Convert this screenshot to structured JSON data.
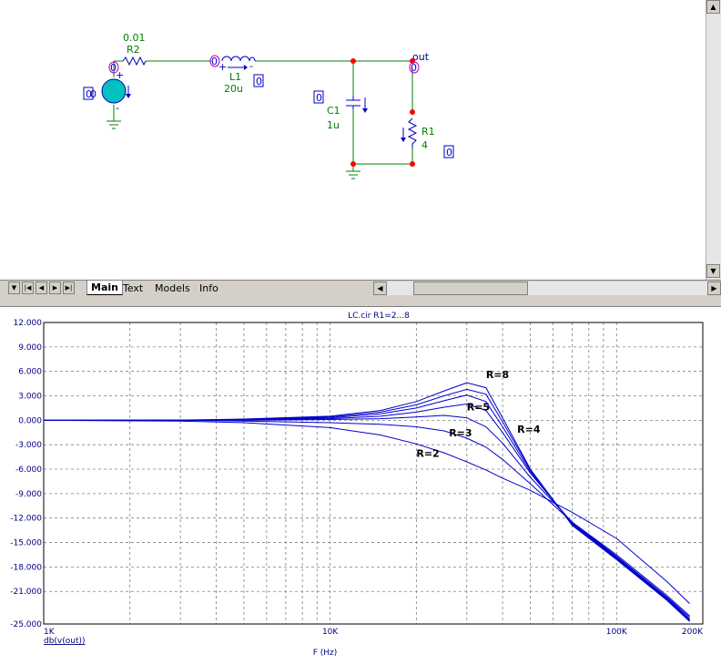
{
  "schematic": {
    "components": [
      {
        "ref": "R2",
        "value": "0.01"
      },
      {
        "ref": "L1",
        "value": "20u"
      },
      {
        "ref": "C1",
        "value": "1u"
      },
      {
        "ref": "R1",
        "value": "4"
      }
    ],
    "node_label_out": "out",
    "source_label": "0",
    "source_sign_plus": "+",
    "source_sign_minus": "-",
    "inductor_sign_plus": "+",
    "inductor_sign_minus": "-",
    "node_zero": "0",
    "wire_color": "#008000",
    "component_color": "#0000c0",
    "label_color": "#008000",
    "node_color": "#ff0000"
  },
  "tabs": [
    {
      "label": "Main",
      "active": true
    },
    {
      "label": "Text",
      "active": false
    },
    {
      "label": "Models",
      "active": false
    },
    {
      "label": "Info",
      "active": false
    }
  ],
  "chart_data": {
    "type": "line",
    "title": "LC.cir R1=2...8",
    "xlabel": "F (Hz)",
    "ylabel": "db(v(out))",
    "xscale": "log",
    "xlim": [
      1000,
      200000
    ],
    "ylim": [
      -25,
      12
    ],
    "x_ticks": [
      "1K",
      "10K",
      "100K",
      "200K"
    ],
    "y_ticks": [
      "12.000",
      "9.000",
      "6.000",
      "3.000",
      "0.000",
      "-3.000",
      "-6.000",
      "-9.000",
      "-12.000",
      "-15.000",
      "-18.000",
      "-21.000",
      "-25.000"
    ],
    "grid": true,
    "line_color": "#0000cc",
    "x": [
      1000,
      3000,
      5000,
      10000,
      15000,
      20000,
      25000,
      30000,
      35000,
      40000,
      50000,
      70000,
      100000,
      150000,
      180000
    ],
    "series": [
      {
        "values": [
          0,
          -0.1,
          -0.3,
          -0.9,
          -1.8,
          -2.9,
          -4.0,
          -5.1,
          -6.1,
          -7.1,
          -8.6,
          -11.3,
          -14.5,
          -19.8,
          -22.5
        ]
      },
      {
        "values": [
          0,
          0,
          -0.1,
          -0.3,
          -0.5,
          -0.8,
          -1.3,
          -2.2,
          -3.3,
          -4.8,
          -7.8,
          -12.5,
          -16.5,
          -21.5,
          -24.0
        ]
      },
      {
        "values": [
          0,
          0,
          0,
          0.1,
          0.2,
          0.4,
          0.6,
          0.3,
          -0.8,
          -2.8,
          -7.0,
          -12.5,
          -16.7,
          -21.7,
          -24.2
        ]
      },
      {
        "values": [
          0,
          0,
          0.05,
          0.2,
          0.5,
          1.0,
          1.6,
          2.0,
          1.2,
          -1.5,
          -6.5,
          -12.6,
          -16.8,
          -21.8,
          -24.4
        ]
      },
      {
        "values": [
          0,
          0,
          0.1,
          0.3,
          0.8,
          1.5,
          2.4,
          3.1,
          2.3,
          -0.8,
          -6.3,
          -12.7,
          -16.9,
          -21.9,
          -24.5
        ]
      },
      {
        "values": [
          0,
          0.02,
          0.1,
          0.4,
          1.0,
          1.9,
          3.0,
          3.8,
          3.2,
          -0.2,
          -6.1,
          -12.8,
          -17.0,
          -22.0,
          -24.6
        ]
      },
      {
        "values": [
          0,
          0.03,
          0.15,
          0.5,
          1.2,
          2.3,
          3.6,
          4.6,
          4.0,
          0.3,
          -6.0,
          -12.9,
          -17.1,
          -22.1,
          -24.7
        ]
      }
    ],
    "annotations": [
      {
        "text": "R=8",
        "x": 35000,
        "y": 5.2
      },
      {
        "text": "R=5",
        "x": 30000,
        "y": 1.2
      },
      {
        "text": "R=4",
        "x": 45000,
        "y": -1.5
      },
      {
        "text": "R=3",
        "x": 26000,
        "y": -2.0
      },
      {
        "text": "R=2",
        "x": 20000,
        "y": -4.5
      }
    ]
  }
}
